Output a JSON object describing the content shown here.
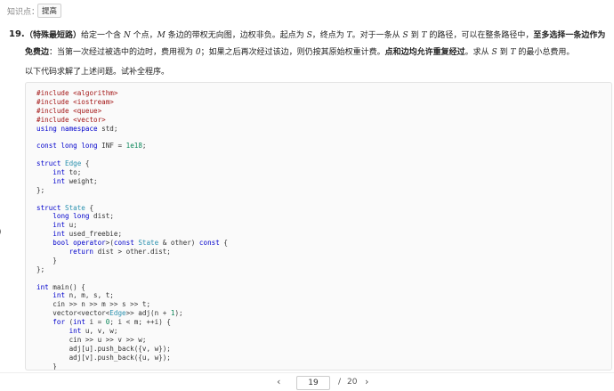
{
  "header": {
    "knowledge_label": "知识点：",
    "knowledge_tag": "提高"
  },
  "question": {
    "number": "19.",
    "title": "（特殊最短路）",
    "t1": "给定一个含 ",
    "v_N": "N",
    "t2": " 个点，",
    "v_M": "M",
    "t3": " 条边的带权无向图，边权非负。起点为 ",
    "v_S": "S",
    "t4": "，终点为 ",
    "v_T": "T",
    "t5": "。对于一条从 ",
    "v_S2": "S",
    "t6": " 到 ",
    "v_T2": "T",
    "t7": " 的路径，可以在整条路径中，",
    "b1": "至多选择一条边作为免费边",
    "t8": "：当第一次经过被选中的边时，费用视为 ",
    "v_zero": "0",
    "t9": "；如果之后再次经过该边，则仍按其原始权重计费。",
    "b2": "点和边均允许重复经过",
    "t10": "。求从 ",
    "v_S3": "S",
    "t11": " 到 ",
    "v_T3": "T",
    "t12": " 的最小总费用。",
    "lead": "以下代码求解了上述问题。试补全程序。"
  },
  "code": {
    "lines": [
      "#include <algorithm>",
      "#include <iostream>",
      "#include <queue>",
      "#include <vector>",
      "using namespace std;",
      "",
      "const long long INF = 1e18;",
      "",
      "struct Edge {",
      "    int to;",
      "    int weight;",
      "};",
      "",
      "struct State {",
      "    long long dist;",
      "    int u;",
      "    int used_freebie;",
      "    bool operator>(const State & other) const {",
      "        return dist > other.dist;",
      "    }",
      "};",
      "",
      "int main() {",
      "    int n, m, s, t;",
      "    cin >> n >> m >> s >> t;",
      "    vector<vector<Edge>> adj(n + 1);",
      "    for (int i = 0; i < m; ++i) {",
      "        int u, v, w;",
      "        cin >> u >> v >> w;",
      "        adj[u].push_back({v, w});",
      "        adj[v].push_back({u, w});",
      "    }"
    ]
  },
  "side_mark": ")",
  "pager": {
    "prev": "‹",
    "current": "19",
    "sep": "/",
    "total": "20",
    "next": "›"
  }
}
